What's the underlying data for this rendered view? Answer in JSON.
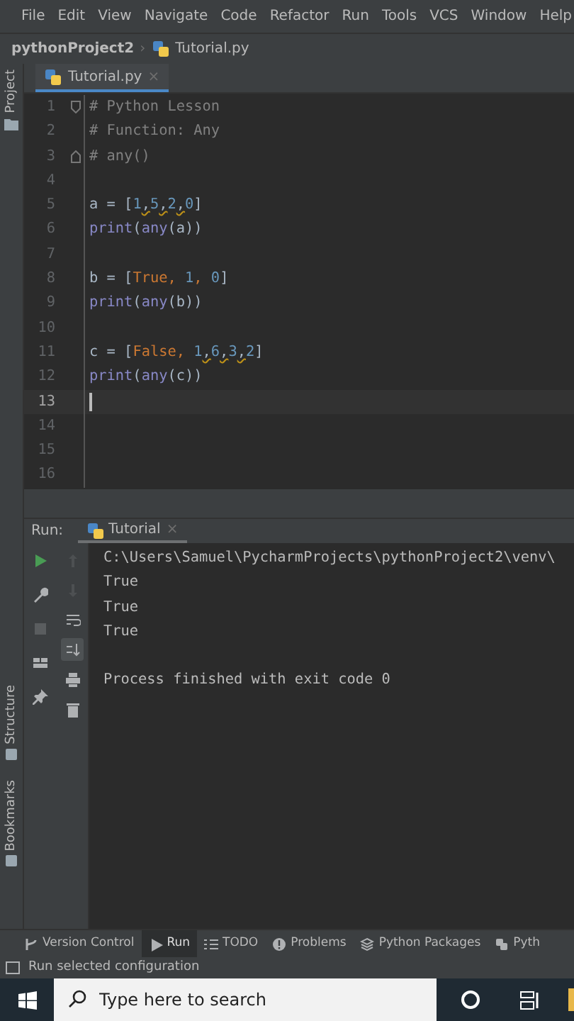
{
  "menu": [
    "File",
    "Edit",
    "View",
    "Navigate",
    "Code",
    "Refactor",
    "Run",
    "Tools",
    "VCS",
    "Window",
    "Help"
  ],
  "breadcrumb": {
    "project": "pythonProject2",
    "separator": "›",
    "file": "Tutorial.py"
  },
  "left_stripe": {
    "top": [
      "Project"
    ],
    "bottom": [
      "Structure",
      "Bookmarks"
    ]
  },
  "editor": {
    "tabs": [
      {
        "label": "Tutorial.py",
        "close": "×",
        "selected": true
      }
    ],
    "lines": [
      {
        "number": "1",
        "current": false,
        "tokens": [
          {
            "text": "# Python Lesson",
            "kind": "comment"
          }
        ]
      },
      {
        "number": "2",
        "current": false,
        "tokens": [
          {
            "text": "# Function: Any",
            "kind": "comment"
          }
        ]
      },
      {
        "number": "3",
        "current": false,
        "tokens": [
          {
            "text": "# any()",
            "kind": "comment"
          }
        ]
      },
      {
        "number": "4",
        "current": false
      },
      {
        "number": "5",
        "current": false,
        "tokens": [
          {
            "text": "a = ",
            "kind": "plain"
          },
          {
            "text": "[",
            "kind": "bracket"
          },
          {
            "text": "1",
            "kind": "number"
          },
          {
            "text": ",",
            "kind": "warn"
          },
          {
            "text": "5",
            "kind": "number"
          },
          {
            "text": ",",
            "kind": "warn"
          },
          {
            "text": "2",
            "kind": "number"
          },
          {
            "text": ",",
            "kind": "warn"
          },
          {
            "text": "0",
            "kind": "number"
          },
          {
            "text": "]",
            "kind": "bracket"
          }
        ]
      },
      {
        "number": "6",
        "current": false,
        "tokens": [
          {
            "text": "print",
            "kind": "builtin"
          },
          {
            "text": "(",
            "kind": "plain"
          },
          {
            "text": "any",
            "kind": "builtin"
          },
          {
            "text": "(a))",
            "kind": "plain"
          }
        ]
      },
      {
        "number": "7",
        "current": false
      },
      {
        "number": "8",
        "current": false,
        "tokens": [
          {
            "text": "b = ",
            "kind": "plain"
          },
          {
            "text": "[",
            "kind": "bracket"
          },
          {
            "text": "True, ",
            "kind": "keyword"
          },
          {
            "text": "1",
            "kind": "number"
          },
          {
            "text": ", ",
            "kind": "keyword"
          },
          {
            "text": "0",
            "kind": "number"
          },
          {
            "text": "]",
            "kind": "bracket"
          }
        ]
      },
      {
        "number": "9",
        "current": false,
        "tokens": [
          {
            "text": "print",
            "kind": "builtin"
          },
          {
            "text": "(",
            "kind": "plain"
          },
          {
            "text": "any",
            "kind": "builtin"
          },
          {
            "text": "(b))",
            "kind": "plain"
          }
        ]
      },
      {
        "number": "10",
        "current": false
      },
      {
        "number": "11",
        "current": false,
        "tokens": [
          {
            "text": "c = ",
            "kind": "plain"
          },
          {
            "text": "[",
            "kind": "bracket"
          },
          {
            "text": "False, ",
            "kind": "keyword"
          },
          {
            "text": "1",
            "kind": "number"
          },
          {
            "text": ",",
            "kind": "warn"
          },
          {
            "text": "6",
            "kind": "number"
          },
          {
            "text": ",",
            "kind": "warn"
          },
          {
            "text": "3",
            "kind": "number"
          },
          {
            "text": ",",
            "kind": "warn"
          },
          {
            "text": "2",
            "kind": "number"
          },
          {
            "text": "]",
            "kind": "bracket"
          }
        ]
      },
      {
        "number": "12",
        "current": false,
        "tokens": [
          {
            "text": "print",
            "kind": "builtin"
          },
          {
            "text": "(",
            "kind": "plain"
          },
          {
            "text": "any",
            "kind": "builtin"
          },
          {
            "text": "(c))",
            "kind": "plain"
          }
        ]
      },
      {
        "number": "13",
        "current": true
      },
      {
        "number": "14",
        "current": false
      },
      {
        "number": "15",
        "current": false
      },
      {
        "number": "16",
        "current": false
      }
    ]
  },
  "run_panel": {
    "label": "Run:",
    "tabs": [
      {
        "label": "Tutorial",
        "close": "×",
        "selected": true
      }
    ],
    "output": [
      {
        "text": "C:\\Users\\Samuel\\PycharmProjects\\pythonProject2\\venv\\",
        "kind": "command"
      },
      {
        "text": "True",
        "kind": "stdout"
      },
      {
        "text": "True",
        "kind": "stdout"
      },
      {
        "text": "True",
        "kind": "stdout"
      },
      {
        "text": "Process finished with exit code 0",
        "kind": "exit"
      }
    ]
  },
  "tool_windows": [
    {
      "label": "Version Control",
      "selected": false
    },
    {
      "label": "Run",
      "selected": true
    },
    {
      "label": "TODO",
      "selected": false
    },
    {
      "label": "Problems",
      "selected": false
    },
    {
      "label": "Python Packages",
      "selected": false
    },
    {
      "label": "Pyth",
      "selected": false
    }
  ],
  "status_bar": {
    "text": "Run selected configuration"
  },
  "taskbar": {
    "search_placeholder": "Type here to search"
  }
}
